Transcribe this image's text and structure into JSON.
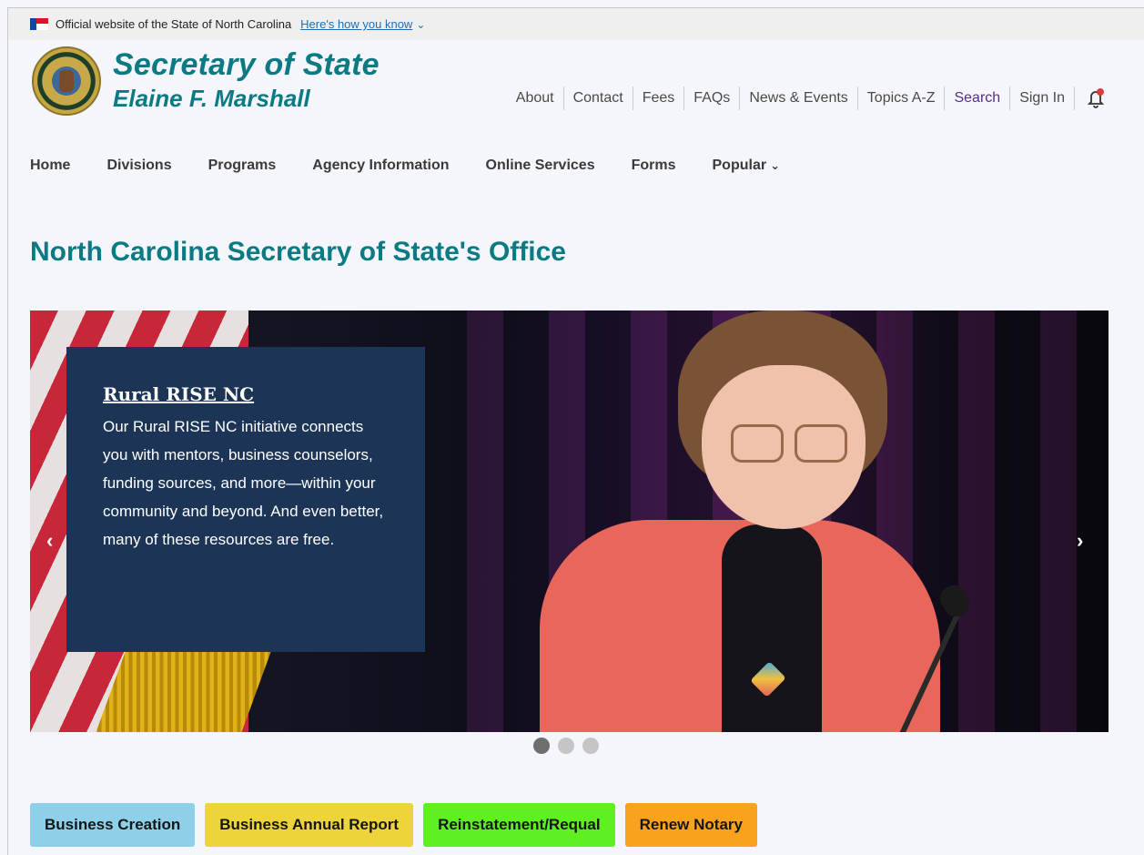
{
  "gov_banner": {
    "text": "Official website of the State of North Carolina",
    "link": "Here's how you know",
    "chevron_icon": "chevron-down-icon"
  },
  "header": {
    "title": "Secretary of State",
    "subtitle": "Elaine F. Marshall",
    "logo_icon": "state-seal-icon"
  },
  "utility_nav": {
    "items": [
      "About",
      "Contact",
      "Fees",
      "FAQs",
      "News & Events",
      "Topics A-Z",
      "Search",
      "Sign In"
    ],
    "bell_icon": "bell-notification-icon"
  },
  "main_nav": {
    "items": [
      "Home",
      "Divisions",
      "Programs",
      "Agency Information",
      "Online Services",
      "Forms",
      "Popular"
    ],
    "popular_chevron": "chevron-down-icon"
  },
  "page_title": "North Carolina Secretary of State's Office",
  "carousel": {
    "slide_title": "Rural RISE NC",
    "slide_text": "Our Rural RISE NC initiative connects you with mentors, business counselors, funding sources, and more—within your community and beyond. And even better, many of these resources are free.",
    "prev_symbol": "‹",
    "next_symbol": "›",
    "slide_count": 3,
    "active_slide": 1
  },
  "quick_links": [
    {
      "label": "Business Creation",
      "color": "#8ecfe9"
    },
    {
      "label": "Business Annual Report",
      "color": "#ecd43a"
    },
    {
      "label": "Reinstatement/Requal",
      "color": "#5ef021"
    },
    {
      "label": "Renew Notary",
      "color": "#f8a21e"
    }
  ]
}
